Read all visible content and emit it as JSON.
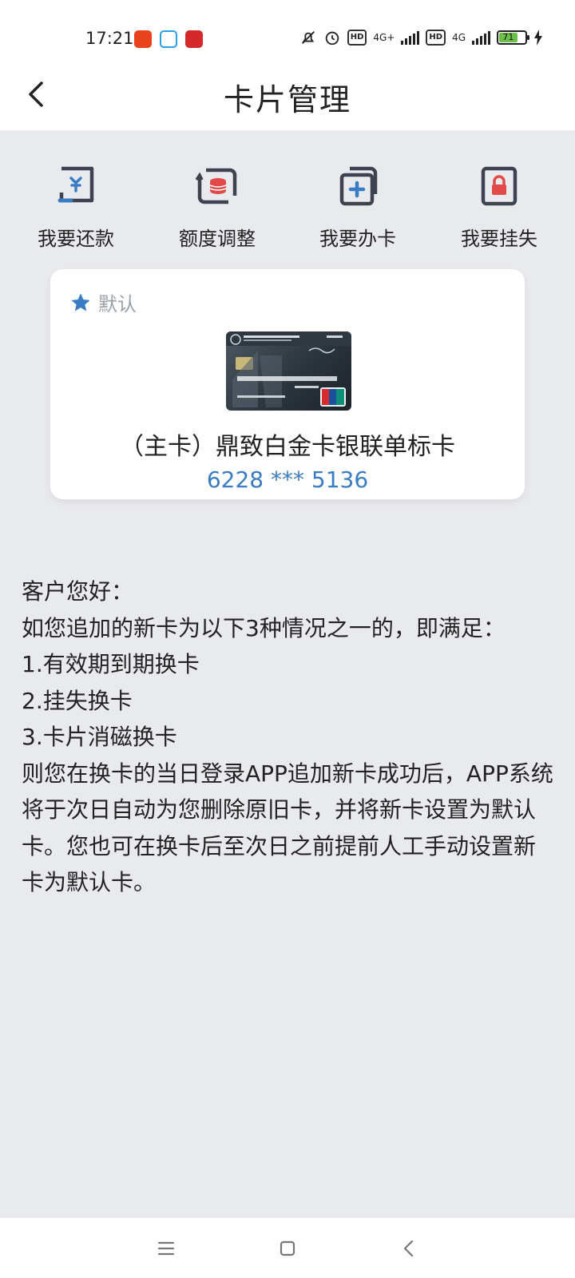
{
  "status_bar": {
    "time": "17:21",
    "network1": "4G+",
    "network2": "4G",
    "battery": "71"
  },
  "header": {
    "title": "卡片管理"
  },
  "actions": [
    {
      "label": "我要还款",
      "icon": "repay-icon"
    },
    {
      "label": "额度调整",
      "icon": "credit-adjust-icon"
    },
    {
      "label": "我要办卡",
      "icon": "apply-card-icon"
    },
    {
      "label": "我要挂失",
      "icon": "report-loss-icon"
    }
  ],
  "card": {
    "default_label": "默认",
    "name": "（主卡）鼎致白金卡银联单标卡",
    "number": "6228 *** 5136"
  },
  "notice": {
    "lines": [
      "客户您好：",
      "如您追加的新卡为以下3种情况之一的，即满足：",
      "1.有效期到期换卡",
      "2.挂失换卡",
      "3.卡片消磁换卡",
      "则您在换卡的当日登录APP追加新卡成功后，APP系统将于次日自动为您删除原旧卡，并将新卡设置为默认卡。您也可在换卡后至次日之前提前人工手动设置新卡为默认卡。"
    ]
  },
  "colors": {
    "accent": "#3a7cc3",
    "lock_red": "#e24a4a",
    "background": "#e9eaee"
  }
}
